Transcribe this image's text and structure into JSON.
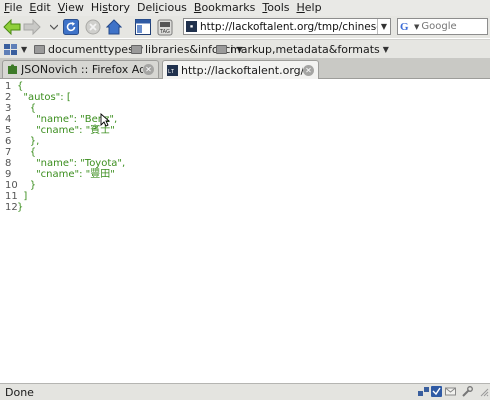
{
  "menubar": {
    "items": [
      {
        "accel": "F",
        "rest": "ile"
      },
      {
        "accel": "E",
        "rest": "dit"
      },
      {
        "accel": "V",
        "rest": "iew"
      },
      {
        "accel": "",
        "pre": "Hi",
        "acc2": "s",
        "rest": "tory"
      },
      {
        "accel": "",
        "pre": "Del",
        "acc2": "i",
        "rest": "cious"
      },
      {
        "accel": "B",
        "rest": "ookmarks"
      },
      {
        "accel": "T",
        "rest": "ools"
      },
      {
        "accel": "H",
        "rest": "elp"
      }
    ]
  },
  "navbar": {
    "url": "http://lackoftalent.org/tmp/chinese.json",
    "search_placeholder": "Google"
  },
  "bookmarks": {
    "items": [
      "documenttypes",
      "libraries&infosci",
      "markup,metadata&formats"
    ]
  },
  "tabs": [
    {
      "title": "JSONovich :: Firefox Add-ons",
      "active": false
    },
    {
      "title": "http://lackoftalent.org/tmp/...",
      "active": true
    }
  ],
  "json_viewer": {
    "line_numbers": [
      "1",
      "2",
      "3",
      "4",
      "5",
      "6",
      "7",
      "8",
      "9",
      "10",
      "11",
      "12"
    ],
    "lines": [
      "{",
      "  \"autos\": [",
      "    {",
      "      \"name\": \"Benz\",",
      "      \"cname\": \"賓士\"",
      "    },",
      "    {",
      "      \"name\": \"Toyota\",",
      "      \"cname\": \"豐田\"",
      "    }",
      "  ]",
      "}"
    ]
  },
  "status": {
    "text": "Done"
  },
  "colors": {
    "json_text": "#3b8e1e",
    "chrome": "#e6e6e2"
  }
}
